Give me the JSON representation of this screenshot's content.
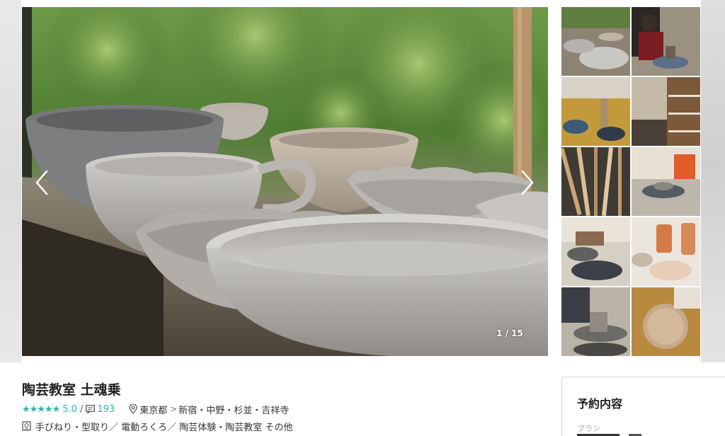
{
  "gallery": {
    "counter": "1 / 15",
    "prev_label": "previous",
    "next_label": "next",
    "thumbnails": [
      "bowls-closeup",
      "wheel-throwing",
      "pottery-wheel-table",
      "studio-shelves",
      "clay-tools",
      "trimming-pot",
      "glazing-hands",
      "finished-pots",
      "wheel-work",
      "plate-forming"
    ]
  },
  "listing": {
    "title": "陶芸教室 土魂乗",
    "stars": "★★★★★",
    "rating": "5.0",
    "separator": "/",
    "reviews": "193",
    "prefecture": "東京都",
    "area": "新宿・中野・杉並・吉祥寺",
    "categories": "手びねり・型取り／ 電動ろくろ／ 陶芸体験・陶芸教室 その他"
  },
  "booking": {
    "title": "予約内容",
    "plan_label": "プラン"
  },
  "colors": {
    "accent": "#2cb7a6"
  }
}
